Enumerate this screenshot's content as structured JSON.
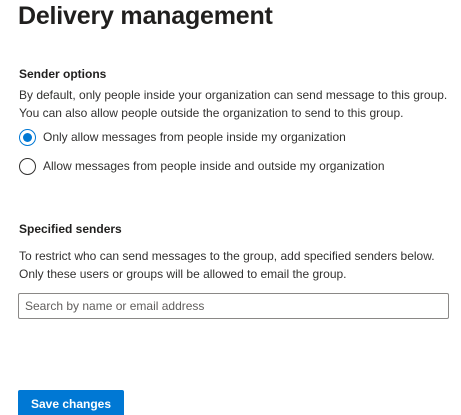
{
  "page": {
    "title": "Delivery management"
  },
  "sender_options": {
    "heading": "Sender options",
    "description_line1": "By default, only people inside your organization can send message to this group.",
    "description_line2": "You can also allow people outside the organization to send to this group.",
    "options": [
      {
        "label": "Only allow messages from people inside my organization",
        "selected": true
      },
      {
        "label": "Allow messages from people inside and outside my organization",
        "selected": false
      }
    ]
  },
  "specified_senders": {
    "heading": "Specified senders",
    "description_line1": "To restrict who can send messages to the group, add specified senders below.",
    "description_line2": "Only these users or groups will be allowed to email the group.",
    "search": {
      "value": "",
      "placeholder": "Search by name or email address"
    }
  },
  "actions": {
    "save_label": "Save changes"
  },
  "colors": {
    "accent": "#0078d4",
    "text": "#323130",
    "heading": "#201f1e",
    "border": "#8a8886"
  }
}
